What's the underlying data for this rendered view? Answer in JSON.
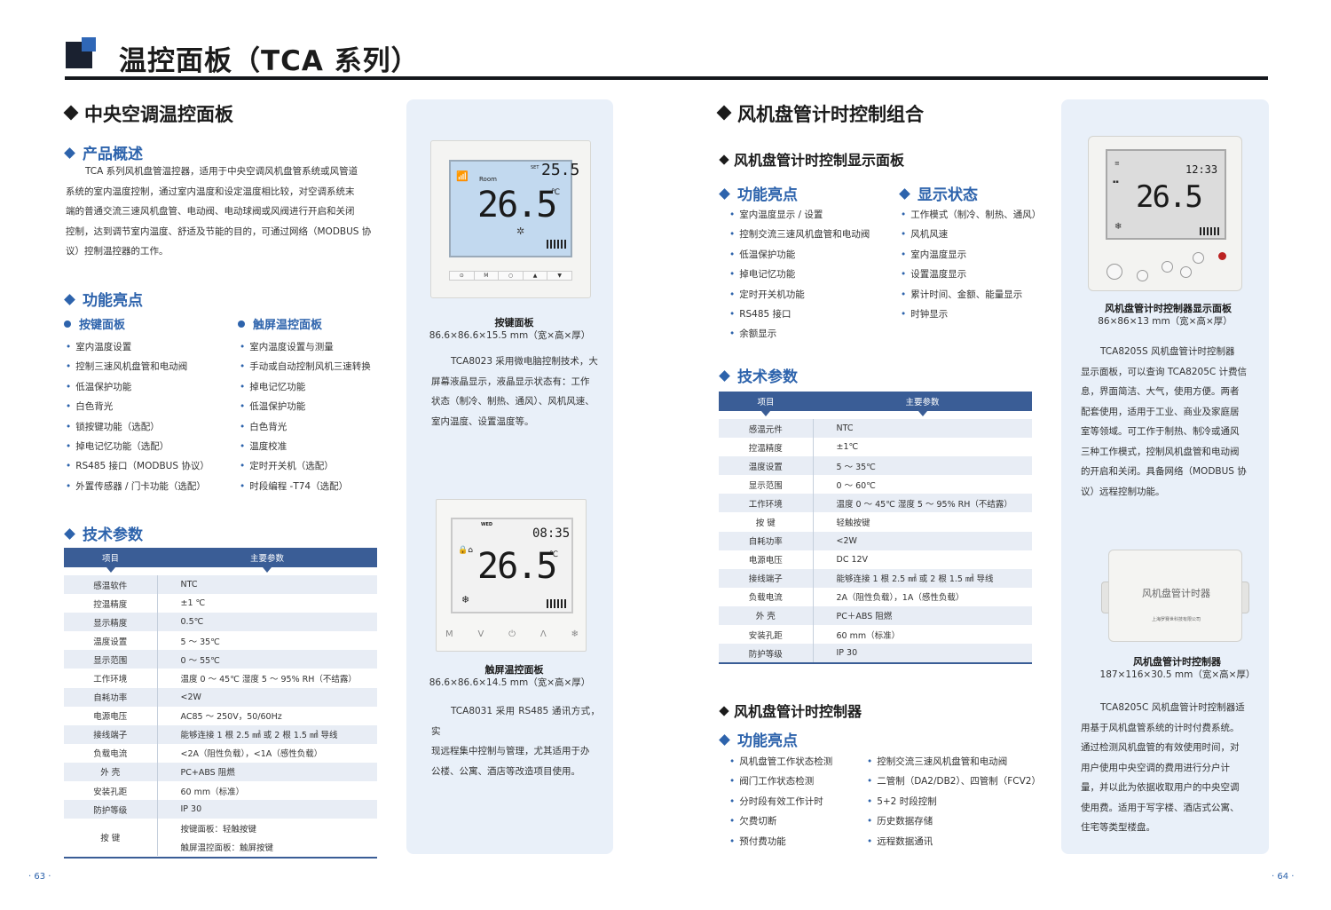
{
  "header": {
    "title": "温控面板（TCA 系列）"
  },
  "left": {
    "section_title": "中央空调温控面板",
    "overview_title": "产品概述",
    "overview_lines": [
      "TCA 系列风机盘管温控器，适用于中央空调风机盘管系统或风管道",
      "系统的室内温度控制，通过室内温度和设定温度相比较，对空调系统末",
      "端的普通交流三速风机盘管、电动阀、电动球阀或风阀进行开启和关闭",
      "控制，达到调节室内温度、舒适及节能的目的，可通过网络（MODBUS 协",
      "议）控制温控器的工作。"
    ],
    "features_title": "功能亮点",
    "key_panel_title": "按键面板",
    "key_panel_items": [
      "室内温度设置",
      "控制三速风机盘管和电动阀",
      "低温保护功能",
      "白色背光",
      "锁按键功能（选配）",
      "掉电记忆功能（选配）",
      "RS485 接口（MODBUS 协议）",
      "外置传感器 / 门卡功能（选配）"
    ],
    "touch_panel_title": "触屏温控面板",
    "touch_panel_items": [
      "室内温度设置与测量",
      "手动或自动控制风机三速转换",
      "掉电记忆功能",
      "低温保护功能",
      "白色背光",
      "温度校准",
      "定时开关机（选配）",
      "时段编程 -T74（选配）"
    ],
    "tech_title": "技术参数",
    "table_headers": [
      "项目",
      "主要参数"
    ],
    "table_rows": [
      [
        "感温软件",
        "NTC"
      ],
      [
        "控温精度",
        "±1 ℃"
      ],
      [
        "显示精度",
        "0.5℃"
      ],
      [
        "温度设置",
        "5 ～ 35℃"
      ],
      [
        "显示范围",
        "0 ～ 55℃"
      ],
      [
        "工作环境",
        "温度 0 ～ 45℃    湿度 5 ～ 95% RH（不结露）"
      ],
      [
        "自耗功率",
        "<2W"
      ],
      [
        "电源电压",
        "AC85 ～ 250V，50/60Hz"
      ],
      [
        "接线端子",
        "能够连接 1 根 2.5 ㎟ 或 2 根 1.5 ㎟ 导线"
      ],
      [
        "负载电流",
        "<2A（阻性负载），<1A（感性负载）"
      ],
      [
        "外  壳",
        "PC+ABS 阻燃"
      ],
      [
        "安装孔距",
        "60 mm（标准）"
      ],
      [
        "防护等级",
        "IP 30"
      ]
    ],
    "table_last": {
      "label": "按  键",
      "line1": "按键面板：轻触按键",
      "line2": "触屏温控面板：触屏按键"
    },
    "page": "· 63 ·"
  },
  "panel1": {
    "lcd_room": "Room",
    "lcd_set": "SET",
    "lcd_set_value": "25.5",
    "lcd_value": "26.5",
    "lcd_unit": "℃",
    "buttons": [
      "⊙",
      "M",
      "○",
      "▲",
      "▼"
    ],
    "caption_title": "按键面板",
    "caption_size": "86.6×86.6×15.5 mm（宽×高×厚）",
    "desc_lines": [
      "TCA8023 采用微电脑控制技术，大",
      "屏幕液晶显示，液晶显示状态有：工作",
      "状态（制冷、制热、通风）、风机风速、",
      "室内温度、设置温度等。"
    ],
    "lcd2_day": "WED",
    "lcd2_time": "08:35",
    "lcd2_value": "26.5",
    "lcd2_unit": "℃",
    "touch_keys": [
      "M",
      "V",
      "⏻",
      "Λ",
      "❄"
    ],
    "caption2_title": "触屏温控面板",
    "caption2_size": "86.6×86.6×14.5 mm（宽×高×厚）",
    "desc2_lines": [
      "TCA8031 采用 RS485 通讯方式，实",
      "现远程集中控制与管理，尤其适用于办",
      "公楼、公寓、酒店等改造项目使用。"
    ]
  },
  "right": {
    "section_title": "风机盘管计时控制组合",
    "sub1_title": "风机盘管计时控制显示面板",
    "features_title": "功能亮点",
    "features": [
      "室内温度显示 / 设置",
      "控制交流三速风机盘管和电动阀",
      "低温保护功能",
      "掉电记忆功能",
      "定时开关机功能",
      "RS485 接口",
      "余额显示"
    ],
    "status_title": "显示状态",
    "status": [
      "工作模式（制冷、制热、通风）",
      "风机风速",
      "室内温度显示",
      "设置温度显示",
      "累计时间、金额、能量显示",
      "时钟显示"
    ],
    "tech_title": "技术参数",
    "table_headers": [
      "项目",
      "主要参数"
    ],
    "table_rows": [
      [
        "感温元件",
        "NTC"
      ],
      [
        "控温精度",
        "±1℃"
      ],
      [
        "温度设置",
        "5 ～ 35℃"
      ],
      [
        "显示范围",
        "0 ～ 60℃"
      ],
      [
        "工作环境",
        "温度 0 ～ 45℃     湿度 5 ～ 95% RH（不结露）"
      ],
      [
        "按  键",
        "轻触按键"
      ],
      [
        "自耗功率",
        "<2W"
      ],
      [
        "电源电压",
        "DC 12V"
      ],
      [
        "接线端子",
        "能够连接 1 根 2.5 ㎟ 或 2 根 1.5 ㎟ 导线"
      ],
      [
        "负载电流",
        "2A（阻性负载），1A（感性负载）"
      ],
      [
        "外  壳",
        "PC＋ABS 阻燃"
      ],
      [
        "安装孔距",
        "60 mm（标准）"
      ],
      [
        "防护等级",
        "IP 30"
      ]
    ],
    "sub2_title": "风机盘管计时控制器",
    "features2_title": "功能亮点",
    "features2_left": [
      "风机盘管工作状态检测",
      "阀门工作状态检测",
      "分时段有效工作计时",
      "欠费切断",
      "预付费功能"
    ],
    "features2_right": [
      "控制交流三速风机盘管和电动阀",
      "二管制（DA2/DB2）、四管制（FCV2）",
      "5+2 时段控制",
      "历史数据存储",
      "远程数据通讯"
    ],
    "page": "· 64 ·"
  },
  "panel2": {
    "lcd_time": "12:33",
    "lcd_value": "26.5",
    "caption_title": "风机盘管计时控制器显示面板",
    "caption_size": "86×86×13 mm（宽×高×厚）",
    "desc_lines": [
      "TCA8205S 风机盘管计时控制器",
      "显示面板，可以查询 TCA8205C 计费信",
      "息，界面简洁、大气，使用方便。两者",
      "配套使用，适用于工业、商业及家庭居",
      "室等领域。可工作于制热、制冷或通风",
      "三种工作模式，控制风机盘管和电动阀",
      "的开启和关闭。具备网络（MODBUS 协",
      "议）远程控制功能。"
    ],
    "box_label": "风机盘管计时器",
    "box_company": "上海罗赛世科技有限公司",
    "caption2_title": "风机盘管计时控制器",
    "caption2_size": "187×116×30.5 mm（宽×高×厚）",
    "desc2_lines": [
      "TCA8205C 风机盘管计时控制器适",
      "用基于风机盘管系统的计时付费系统。",
      "通过检测风机盘管的有效使用时间，对",
      "用户使用中央空调的费用进行分户计",
      "量，并以此为依据收取用户的中央空调",
      "使用费。适用于写字楼、酒店式公寓、",
      "住宅等类型楼盘。"
    ]
  }
}
